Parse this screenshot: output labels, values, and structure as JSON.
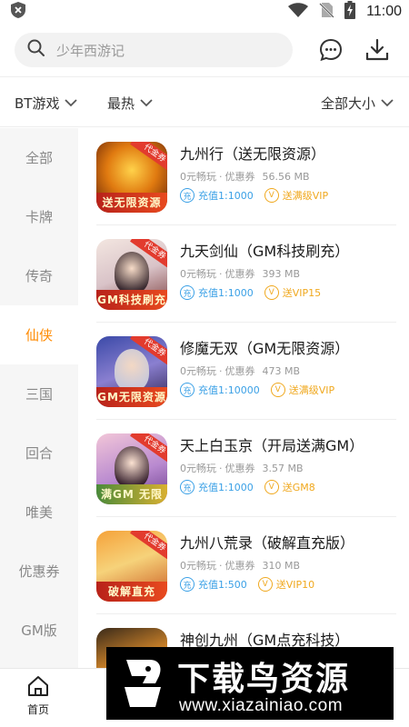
{
  "status_bar": {
    "time": "11:00"
  },
  "search": {
    "placeholder": "少年西游记"
  },
  "filters": {
    "category": "BT游戏",
    "sort": "最热",
    "size": "全部大小"
  },
  "sidebar": {
    "items": [
      {
        "label": "全部",
        "active": false
      },
      {
        "label": "卡牌",
        "active": false
      },
      {
        "label": "传奇",
        "active": false
      },
      {
        "label": "仙侠",
        "active": true
      },
      {
        "label": "三国",
        "active": false
      },
      {
        "label": "回合",
        "active": false
      },
      {
        "label": "唯美",
        "active": false
      },
      {
        "label": "优惠券",
        "active": false
      },
      {
        "label": "GM版",
        "active": false
      }
    ]
  },
  "games": [
    {
      "title": "九州行（送无限资源）",
      "meta_a": "0元畅玩",
      "meta_b": "优惠券",
      "size": "56.56 MB",
      "recharge": "充值1:1000",
      "vip": "送满级VIP",
      "thumb_tag": "代金券",
      "thumb_banner": "送无限资源"
    },
    {
      "title": "九天剑仙（GM科技刷充）",
      "meta_a": "0元畅玩",
      "meta_b": "优惠券",
      "size": "393 MB",
      "recharge": "充值1:1000",
      "vip": "送VIP15",
      "thumb_tag": "代金券",
      "thumb_banner": "GM科技刷充"
    },
    {
      "title": "修魔无双（GM无限资源）",
      "meta_a": "0元畅玩",
      "meta_b": "优惠券",
      "size": "473 MB",
      "recharge": "充值1:10000",
      "vip": "送满级VIP",
      "thumb_tag": "代金券",
      "thumb_banner": "GM无限资源"
    },
    {
      "title": "天上白玉京（开局送满GM）",
      "meta_a": "0元畅玩",
      "meta_b": "优惠券",
      "size": "3.57 MB",
      "recharge": "充值1:1000",
      "vip": "送GM8",
      "thumb_tag": "代金券",
      "thumb_banner": "满GM 无限抽"
    },
    {
      "title": "九州八荒录（破解直充版）",
      "meta_a": "0元畅玩",
      "meta_b": "优惠券",
      "size": "310 MB",
      "recharge": "充值1:500",
      "vip": "送VIP10",
      "thumb_tag": "代金券",
      "thumb_banner": "破解直充"
    },
    {
      "title": "神创九州（GM点充科技）",
      "meta_a": "",
      "meta_b": "",
      "size": "",
      "recharge": "",
      "vip": "",
      "thumb_tag": "",
      "thumb_banner": ""
    }
  ],
  "bottom_nav": {
    "home_label": "首页"
  },
  "watermark": {
    "text": "下载鸟资源",
    "url": "www.xiazainiao.com"
  },
  "colors": {
    "accent": "#ff8a00",
    "recharge": "#3aa0e6",
    "vip": "#f0a81e"
  },
  "icons": {
    "status_left": "shield-icon",
    "status_right": [
      "wifi-icon",
      "no-sim-icon",
      "battery-charging-icon"
    ],
    "header": [
      "message-icon",
      "download-icon"
    ],
    "nav": "home-icon"
  }
}
